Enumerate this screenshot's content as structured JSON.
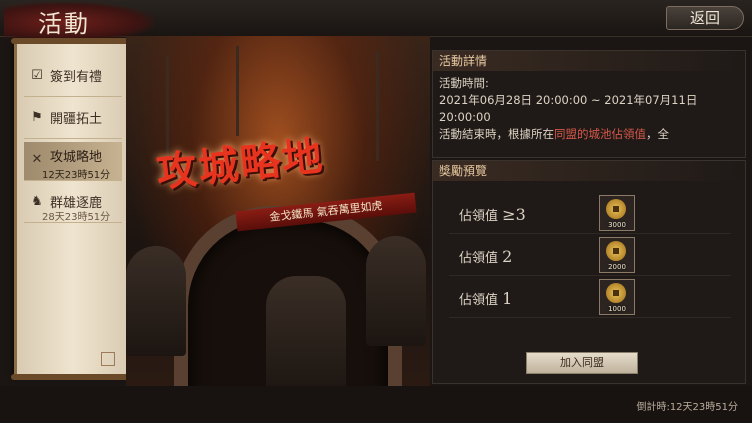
{
  "header": {
    "title": "活動",
    "back_label": "返回"
  },
  "sidebar": {
    "items": [
      {
        "label": "簽到有禮",
        "icon": "checklist-icon",
        "sub": ""
      },
      {
        "label": "開疆拓土",
        "icon": "flag-icon",
        "sub": ""
      },
      {
        "label": "攻城略地",
        "icon": "crossed-swords-icon",
        "sub": "12天23時51分"
      },
      {
        "label": "群雄逐鹿",
        "icon": "deer-icon",
        "sub": "28天23時51分"
      }
    ],
    "active_index": 2
  },
  "banner": {
    "title": "攻城略地",
    "subtitle": "金戈鐵馬 氣吞萬里如虎"
  },
  "details": {
    "heading": "活動詳情",
    "time_label": "活動時間:",
    "time_range": "2021年06月28日 20:00:00 ~ 2021年07月11日",
    "time_end": "20:00:00",
    "desc_prefix": "活動結束時，根據所在",
    "desc_highlight": "同盟的城池佔領值",
    "desc_suffix": "，全"
  },
  "rewards": {
    "heading": "獎勵預覽",
    "rows": [
      {
        "label": "佔領值",
        "value": "≥3",
        "count": "3000",
        "icon": "coin-icon"
      },
      {
        "label": "佔領值",
        "value": "2",
        "count": "2000",
        "icon": "coin-icon"
      },
      {
        "label": "佔領值",
        "value": "1",
        "count": "1000",
        "icon": "coin-icon"
      }
    ],
    "join_label": "加入同盟"
  },
  "footer": {
    "countdown": "倒計時:12天23時51分"
  },
  "colors": {
    "accent_red": "#e8341e",
    "highlight_red": "#d6584a",
    "heading_gold": "#e7c9a0"
  }
}
